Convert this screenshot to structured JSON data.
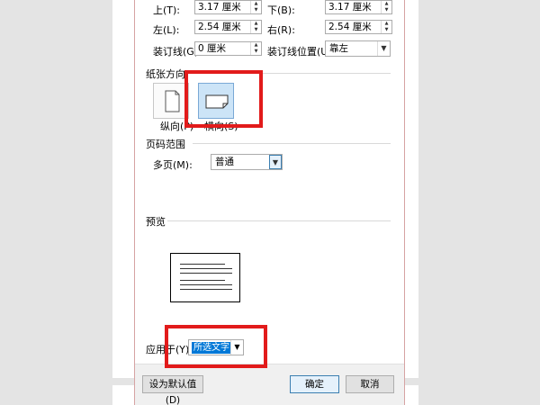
{
  "margins": {
    "top": {
      "label": "上(T):",
      "value": "3.17 厘米"
    },
    "bottom": {
      "label": "下(B):",
      "value": "3.17 厘米"
    },
    "left": {
      "label": "左(L):",
      "value": "2.54 厘米"
    },
    "right": {
      "label": "右(R):",
      "value": "2.54 厘米"
    },
    "gutter": {
      "label": "装订线(G):",
      "value": "0 厘米"
    },
    "gutter_position": {
      "label": "装订线位置(U):",
      "value": "靠左"
    }
  },
  "orientation": {
    "title": "纸张方向",
    "portrait_label": "纵向(P)",
    "landscape_label": "横向(S)",
    "selected": "landscape"
  },
  "page_range": {
    "title": "页码范围",
    "multiple_pages_label": "多页(M):",
    "multiple_pages_value": "普通"
  },
  "preview": {
    "title": "预览",
    "line_count": 6
  },
  "apply_to": {
    "label": "应用于(Y):",
    "value": "所选文字"
  },
  "buttons": {
    "set_default": "设为默认值(D)",
    "ok": "确定",
    "cancel": "取消"
  },
  "colors": {
    "highlight": "#e21b1b",
    "selection": "#0078d7"
  }
}
